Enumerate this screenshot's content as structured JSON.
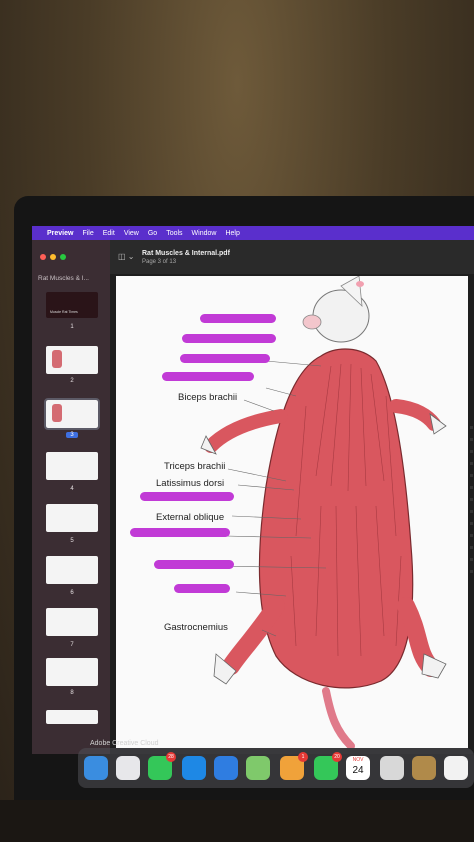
{
  "menubar": {
    "apple": "",
    "app_name": "Preview",
    "items": [
      "File",
      "Edit",
      "View",
      "Go",
      "Tools",
      "Window",
      "Help"
    ]
  },
  "sidebar": {
    "title": "Rat Muscles & I...",
    "first_thumb_caption": "Muscle Rat Times",
    "page_numbers": [
      "1",
      "2",
      "3",
      "4",
      "5",
      "6",
      "7",
      "8"
    ],
    "current_page": "3"
  },
  "toolbar": {
    "sidebar_toggle": "◫ ⌄",
    "doc_title": "Rat Muscles & Internal.pdf",
    "doc_subtitle": "Page 3 of 13"
  },
  "figure": {
    "labels": {
      "biceps": "Biceps brachii",
      "triceps": "Triceps brachii",
      "latissimus": "Latissimus dorsi",
      "external_oblique": "External oblique",
      "gastrocnemius": "Gastrocnemius"
    },
    "highlight_color": "#c13ad6"
  },
  "dock": {
    "caption": "Adobe Creative Cloud",
    "calendar_month": "NOV",
    "calendar_day": "24",
    "badges": [
      "28",
      "1",
      "20"
    ]
  }
}
